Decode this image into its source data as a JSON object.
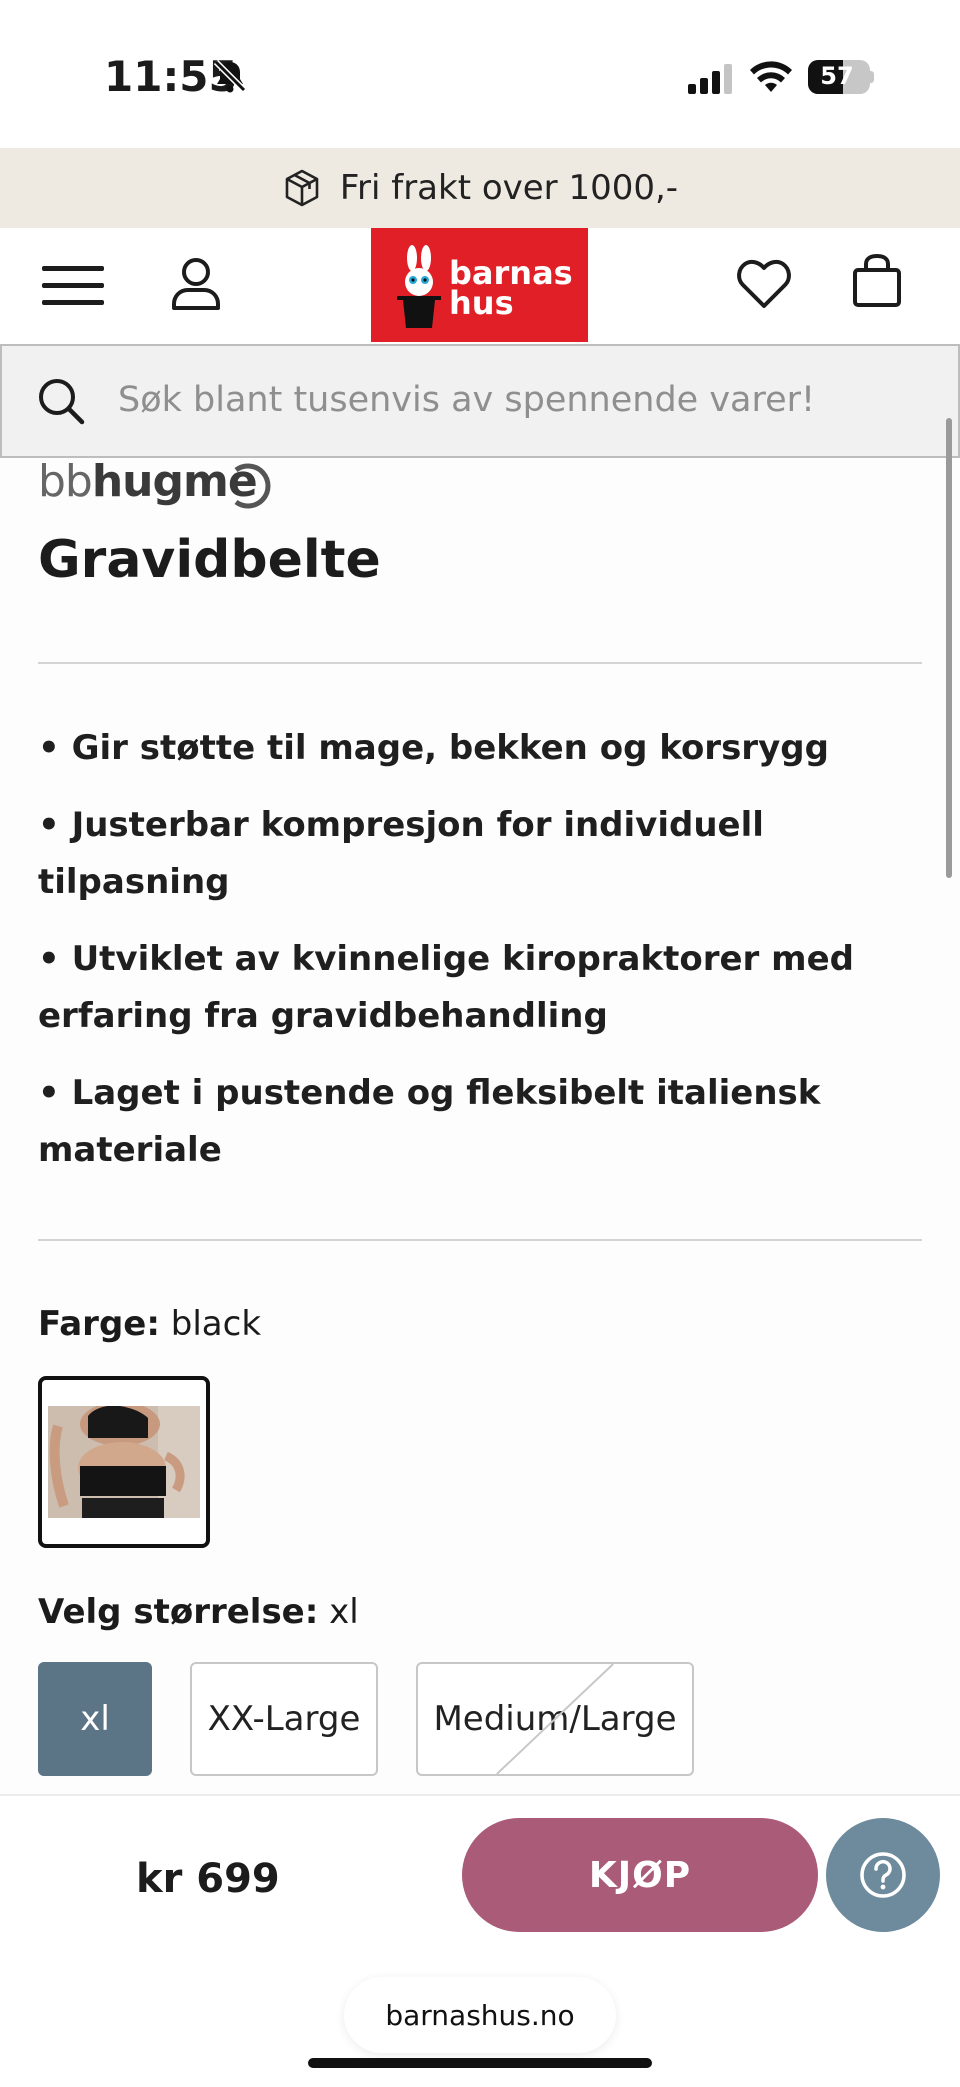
{
  "status_bar": {
    "time": "11:55",
    "battery_percent": 57,
    "battery_label": "57"
  },
  "promo": {
    "text": "Fri frakt over 1000,-"
  },
  "header": {
    "logo_line1": "barnas",
    "logo_line2": "hus",
    "logo_color": "#e01f26"
  },
  "search": {
    "placeholder": "Søk blant tusenvis av spennende varer!"
  },
  "product": {
    "brand_prefix": "bb",
    "brand_main": "hugme",
    "title": "Gravidbelte",
    "bullets": [
      "• Gir støtte til mage, bekken og korsrygg",
      "• Justerbar kompresjon for individuell tilpasning",
      "• Utviklet av kvinnelige kiropraktorer med erfaring fra gravidbehandling",
      "• Laget i pustende og fleksibelt italiensk materiale"
    ],
    "color_label": "Farge:",
    "color_value": "black",
    "size_label": "Velg størrelse:",
    "size_value": "xl",
    "sizes": [
      {
        "label": "xl",
        "selected": true,
        "available": true
      },
      {
        "label": "XX-Large",
        "selected": false,
        "available": true
      },
      {
        "label": "Medium/Large",
        "selected": false,
        "available": false
      }
    ]
  },
  "buy_bar": {
    "price": "kr 699",
    "buy_label": "KJØP",
    "buy_color": "#a95b77",
    "help_color": "#6d8b9c"
  },
  "browser": {
    "url": "barnashus.no"
  }
}
